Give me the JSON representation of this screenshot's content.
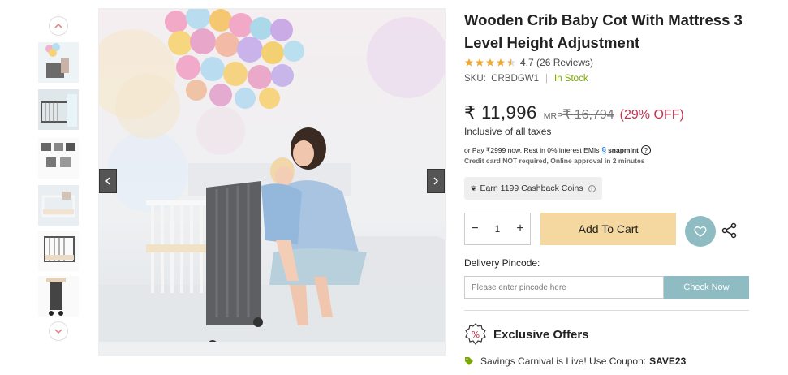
{
  "product": {
    "title": "Wooden Crib Baby Cot With Mattress 3 Level Height Adjustment",
    "rating": "4.7",
    "reviews": "(26 Reviews)",
    "stars_filled": 4.5,
    "sku_label": "SKU:",
    "sku": "CRBDGW1",
    "stock": "In Stock"
  },
  "pricing": {
    "price": "₹ 11,996",
    "mrp_label": "MRP",
    "mrp": "₹ 16,794",
    "discount": "(29% OFF)",
    "tax_note": "Inclusive of all taxes"
  },
  "emi": {
    "text": "or Pay ₹2999 now. Rest in 0% interest EMIs",
    "brand": "snapmint",
    "sub": "Credit card NOT required, Online approval in 2 minutes"
  },
  "cashback": {
    "text": "Earn 1199 Cashback Coins"
  },
  "cart": {
    "qty": "1",
    "minus": "−",
    "plus": "+",
    "add_label": "Add To Cart"
  },
  "delivery": {
    "label": "Delivery Pincode:",
    "placeholder": "Please enter pincode here",
    "button": "Check Now"
  },
  "offers": {
    "title": "Exclusive Offers",
    "coupon_text": "Savings Carnival is Live! Use Coupon:",
    "coupon_code": "SAVE23"
  },
  "colors": {
    "accent": "#8fbcc2",
    "cart": "#f5d8a0",
    "stock": "#7aa800",
    "discount": "#c0334d",
    "star": "#f0a830"
  },
  "icons": {
    "thumb_up": "chevron-up-icon",
    "thumb_down": "chevron-down-icon",
    "prev": "chevron-left-icon",
    "next": "chevron-right-icon",
    "wishlist": "heart-icon",
    "share": "share-icon",
    "offers": "percent-badge-icon",
    "coupon": "tag-icon"
  }
}
